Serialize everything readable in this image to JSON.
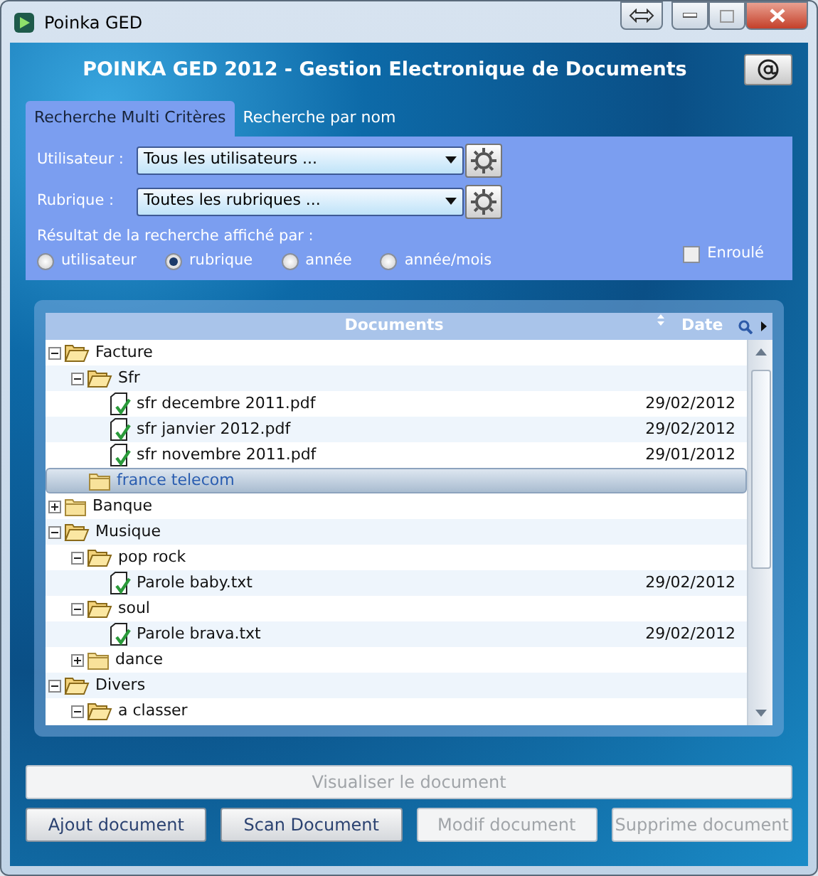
{
  "window": {
    "title": "Poinka GED"
  },
  "header": {
    "title": "POINKA GED 2012 - Gestion Electronique de Documents"
  },
  "tabs": [
    {
      "label": "Recherche Multi Critères",
      "selected": true
    },
    {
      "label": "Recherche par nom",
      "selected": false
    }
  ],
  "filters": [
    {
      "label": "Utilisateur :",
      "value": "Tous les utilisateurs ..."
    },
    {
      "label": "Rubrique :",
      "value": "Toutes les rubriques ..."
    }
  ],
  "display_by": {
    "label": "Résultat de la recherche affiché par :",
    "options": [
      {
        "label": "utilisateur",
        "selected": false
      },
      {
        "label": "rubrique",
        "selected": true
      },
      {
        "label": "année",
        "selected": false
      },
      {
        "label": "année/mois",
        "selected": false
      }
    ]
  },
  "collapsed_option": {
    "label": "Enroulé",
    "checked": false
  },
  "tree": {
    "columns": [
      "Documents",
      "Date"
    ],
    "items": [
      {
        "kind": "folder",
        "name": "Facture",
        "expanded": true,
        "selected": false,
        "children": [
          {
            "kind": "folder",
            "name": "Sfr",
            "expanded": true,
            "selected": false,
            "children": [
              {
                "kind": "file",
                "name": "sfr decembre 2011.pdf",
                "date": "29/02/2012",
                "selected": false
              },
              {
                "kind": "file",
                "name": "sfr janvier 2012.pdf",
                "date": "29/02/2012",
                "selected": false
              },
              {
                "kind": "file",
                "name": "sfr novembre 2011.pdf",
                "date": "29/01/2012",
                "selected": false
              }
            ]
          },
          {
            "kind": "folder",
            "name": "france telecom",
            "selected": true
          }
        ]
      },
      {
        "kind": "folder",
        "name": "Banque",
        "expanded": false,
        "selected": false
      },
      {
        "kind": "folder",
        "name": "Musique",
        "expanded": true,
        "selected": false,
        "children": [
          {
            "kind": "folder",
            "name": "pop rock",
            "expanded": true,
            "selected": false,
            "children": [
              {
                "kind": "file",
                "name": "Parole baby.txt",
                "date": "29/02/2012",
                "selected": false
              }
            ]
          },
          {
            "kind": "folder",
            "name": "soul",
            "expanded": true,
            "selected": false,
            "children": [
              {
                "kind": "file",
                "name": "Parole brava.txt",
                "date": "29/02/2012",
                "selected": false
              }
            ]
          },
          {
            "kind": "folder",
            "name": "dance",
            "expanded": false,
            "selected": false
          }
        ]
      },
      {
        "kind": "folder",
        "name": "Divers",
        "expanded": true,
        "selected": false,
        "children": [
          {
            "kind": "folder",
            "name": "a classer",
            "expanded": true,
            "selected": false
          }
        ]
      }
    ]
  },
  "view_button": {
    "label": "Visualiser le document",
    "disabled": true
  },
  "buttons": [
    {
      "label": "Ajout document",
      "disabled": false
    },
    {
      "label": "Scan Document",
      "disabled": false
    },
    {
      "label": "Modif document",
      "disabled": true
    },
    {
      "label": "Supprime document",
      "disabled": true
    }
  ]
}
